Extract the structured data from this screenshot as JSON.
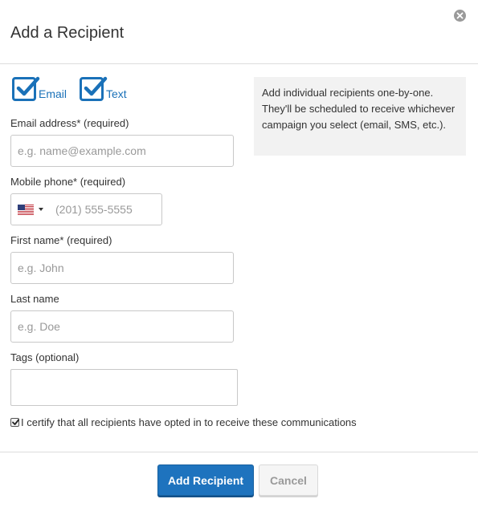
{
  "dialog": {
    "title": "Add a Recipient",
    "close_icon": "close-circle-icon"
  },
  "channels": [
    {
      "label": "Email",
      "checked": true
    },
    {
      "label": "Text",
      "checked": true
    }
  ],
  "fields": {
    "email": {
      "label": "Email address* (required)",
      "placeholder": "e.g. name@example.com",
      "value": ""
    },
    "phone": {
      "label": "Mobile phone* (required)",
      "placeholder": "(201) 555-5555",
      "value": "",
      "country_flag": "us-flag-icon"
    },
    "first_name": {
      "label": "First name* (required)",
      "placeholder": "e.g. John",
      "value": ""
    },
    "last_name": {
      "label": "Last name",
      "placeholder": "e.g. Doe",
      "value": ""
    },
    "tags": {
      "label": "Tags (optional)",
      "value": ""
    }
  },
  "certify": {
    "checked": true,
    "label": "I certify that all recipients have opted in to receive these communications"
  },
  "info": {
    "text": "Add individual recipients one-by-one. They'll be scheduled to receive whichever campaign you select (email, SMS, etc.)."
  },
  "actions": {
    "primary_label": "Add Recipient",
    "secondary_label": "Cancel"
  },
  "colors": {
    "accent": "#1a71b8",
    "primary_button": "#1e73be",
    "info_bg": "#f2f2f2"
  }
}
